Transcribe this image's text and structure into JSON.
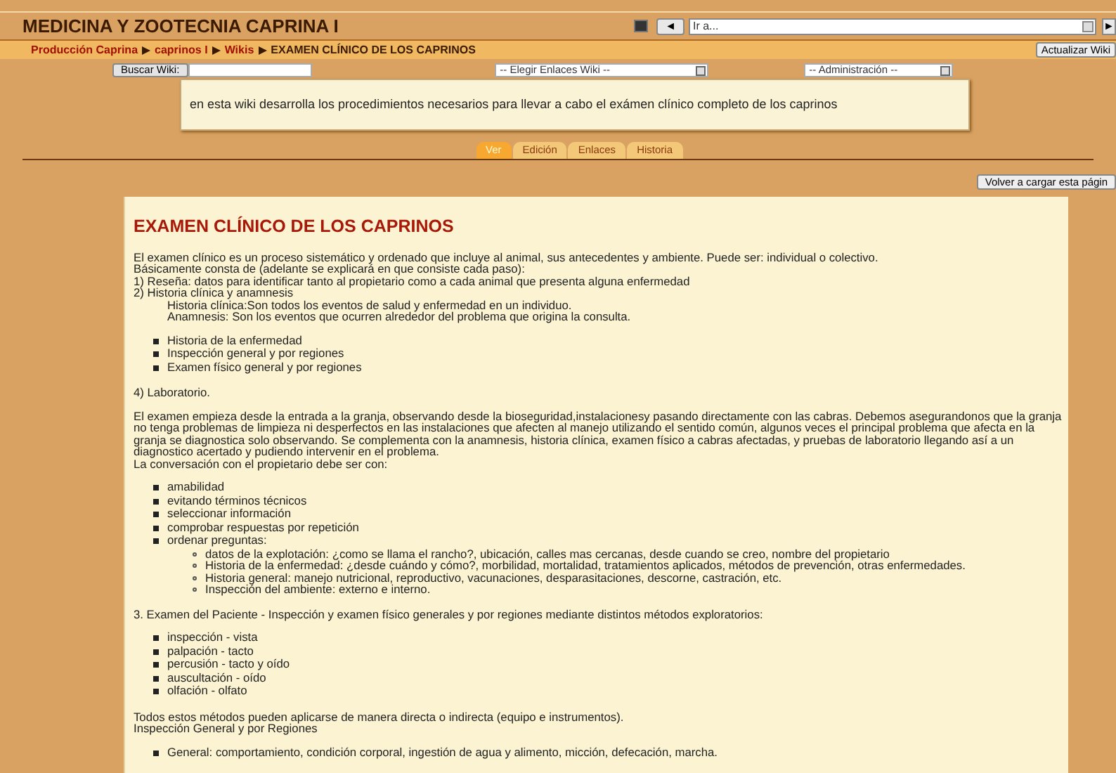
{
  "header": {
    "course_title": "MEDICINA Y ZOOTECNIA CAPRINA I",
    "prev_button": "◄",
    "jump_select": "Ir a...",
    "next_button": "►"
  },
  "breadcrumb": [
    "Producción Caprina",
    "caprinos I",
    "Wikis",
    "EXAMEN CLÍNICO DE LOS CAPRINOS"
  ],
  "update_button": "Actualizar Wiki",
  "toolbar": {
    "search_button": "Buscar Wiki:",
    "links_select": "-- Elegir Enlaces Wiki --",
    "admin_select": "-- Administración --"
  },
  "description": "en esta wiki desarrolla los procedimientos necesarios para llevar a cabo el exámen clínico completo de los caprinos",
  "tabs": [
    {
      "label": "Ver",
      "selected": true
    },
    {
      "label": "Edición",
      "selected": false
    },
    {
      "label": "Enlaces",
      "selected": false
    },
    {
      "label": "Historia",
      "selected": false
    }
  ],
  "reload_button": "Volver a cargar esta págin",
  "article": [
    {
      "kind": "heading",
      "text": "EXAMEN CLÍNICO DE LOS CAPRINOS"
    },
    {
      "kind": "paragraph",
      "lines": [
        "El examen clínico es un proceso sistemático y ordenado que incluye al animal, sus antecedentes y ambiente. Puede ser: individual o colectivo.",
        "Básicamente consta de (adelante se explicará en que consiste cada paso):",
        "1) Reseña: datos para identificar tanto al propietario como a cada animal que presenta alguna enfermedad",
        "2) Historia clínica y anamnesis"
      ]
    },
    {
      "kind": "note",
      "lines": [
        "Historia clínica:Son todos los eventos de salud y enfermedad en un individuo.",
        "Anamnesis: Son los eventos que ocurren alrededor del problema que origina la consulta."
      ]
    },
    {
      "kind": "list",
      "items": [
        {
          "text": "Historia de la enfermedad"
        },
        {
          "text": "Inspección general y por regiones"
        },
        {
          "text": "Examen físico general y por regiones"
        }
      ]
    },
    {
      "kind": "paragraph",
      "lines": [
        "4) Laboratorio."
      ]
    },
    {
      "kind": "paragraph",
      "lines": [
        "El examen empieza desde la entrada a la granja, observando desde la bioseguridad,instalacionesy pasando directamente con las cabras. Debemos asegurandonos que la granja no tenga problemas de limpieza ni desperfectos en las instalaciones que afecten al manejo utilizando el sentido común, algunos veces el principal problema que afecta en la granja se diagnostica solo observando. Se complementa con la anamnesis, historia clínica, examen físico a cabras afectadas, y pruebas de laboratorio llegando así a un diagnostico acertado y pudiendo intervenir en el problema.",
        "La conversación con el propietario debe ser con:"
      ]
    },
    {
      "kind": "list",
      "items": [
        {
          "text": "amabilidad"
        },
        {
          "text": "evitando términos técnicos"
        },
        {
          "text": "seleccionar información"
        },
        {
          "text": "comprobar respuestas por repetición"
        },
        {
          "text": "ordenar preguntas:",
          "children": [
            {
              "text": "datos de la explotación: ¿como se llama el rancho?, ubicación, calles mas cercanas, desde cuando se creo, nombre del propietario"
            },
            {
              "text": "Historia de la enfermedad: ¿desde cuándo y cómo?, morbilidad, mortalidad, tratamientos aplicados, métodos de prevención, otras enfermedades."
            },
            {
              "text": "Historia general: manejo nutricional, reproductivo, vacunaciones, desparasitaciones, descorne, castración, etc."
            },
            {
              "text": "Inspección del ambiente: externo e interno."
            }
          ]
        }
      ]
    },
    {
      "kind": "paragraph",
      "lines": [
        "3. Examen del Paciente - Inspección y examen físico generales y por regiones mediante distintos métodos exploratorios:"
      ]
    },
    {
      "kind": "list",
      "items": [
        {
          "text": "inspección - vista"
        },
        {
          "text": "palpación - tacto"
        },
        {
          "text": "percusión - tacto y oído"
        },
        {
          "text": "auscultación - oído"
        },
        {
          "text": "olfación - olfato"
        }
      ]
    },
    {
      "kind": "paragraph",
      "lines": [
        "Todos estos métodos pueden aplicarse de manera directa o indirecta (equipo e instrumentos).",
        "Inspección General y por Regiones"
      ]
    },
    {
      "kind": "list",
      "items": [
        {
          "text": "General: comportamiento, condición corporal, ingestión de agua y alimento, micción, defecación, marcha."
        }
      ]
    }
  ]
}
